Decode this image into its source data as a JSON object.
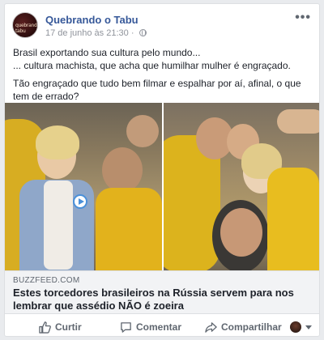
{
  "post": {
    "page_name": "Quebrando o Tabu",
    "timestamp": "17 de junho às 21:30",
    "more_label": "•••",
    "text_lines": [
      "Brasil exportando sua cultura pelo mundo...",
      "... cultura machista, que acha que humilhar mulher é engraçado.",
      "Tão engraçado que tudo bem filmar e espalhar por aí, afinal, o que tem de errado?"
    ],
    "avatar_logo_text": "quebrando tabu"
  },
  "link_preview": {
    "domain": "BUZZFEED.COM",
    "headline": "Estes torcedores brasileiros na Rússia servem para nos lembrar que assédio NÃO é zoeira"
  },
  "actions": {
    "like_label": "Curtir",
    "comment_label": "Comentar",
    "share_label": "Compartilhar"
  },
  "colors": {
    "link_blue": "#365899",
    "meta_gray": "#90949c",
    "action_gray": "#606770",
    "jersey_yellow": "#f2c418"
  }
}
